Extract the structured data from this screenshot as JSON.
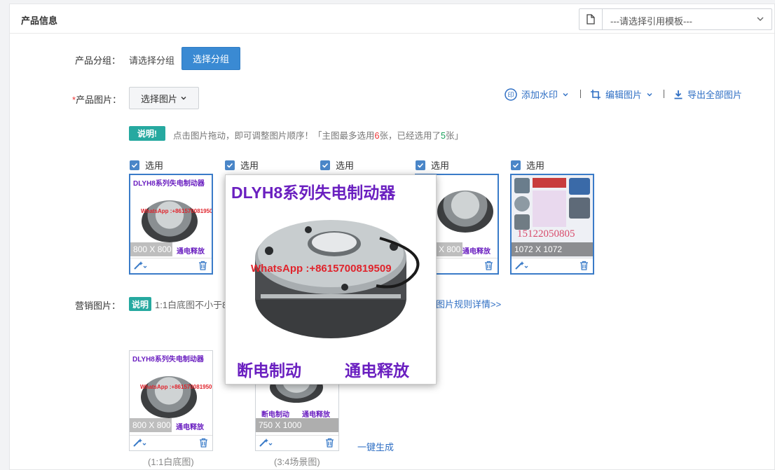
{
  "header": {
    "title": "产品信息",
    "template_select": "---请选择引用模板---"
  },
  "group": {
    "label": "产品分组：",
    "value": "请选择分组",
    "button": "选择分组"
  },
  "images": {
    "required_mark": "*",
    "label": "产品图片：",
    "select_button": "选择图片",
    "tools": {
      "watermark": "添加水印",
      "edit": "编辑图片",
      "export": "导出全部图片"
    },
    "note_badge": "说明!",
    "note_a": "点击图片拖动，即可调整图片顺序！「主图最多选用",
    "note_max": "6",
    "note_b": "张，已经选用了",
    "note_count": "5",
    "note_c": "张」",
    "check_label": "选用",
    "items": [
      {
        "title": "DLYH8系列失电制动器",
        "wa": "WhatsApp :+8615700819509",
        "dim": "800 X 800",
        "bottom": "通电释放"
      },
      {
        "title": "",
        "wa": "",
        "dim": "",
        "bottom": ""
      },
      {
        "title": "",
        "wa": "",
        "dim": "",
        "bottom": ""
      },
      {
        "title": "",
        "wa": "",
        "dim": "X 800",
        "bottom": "通电释放"
      },
      {
        "title": "",
        "wa": "",
        "dim": "1072 X 1072",
        "bottom": "",
        "phone": "15122050805"
      }
    ]
  },
  "popup": {
    "title": "DLYH8系列失电制动器",
    "wa": "WhatsApp :+8615700819509",
    "left": "断电制动",
    "right": "通电释放"
  },
  "marketing": {
    "label": "营销图片：",
    "badge": "说明",
    "desc": "1:1白底图不小于8",
    "rules_link": "图片规则详情>>",
    "items": [
      {
        "title": "DLYH8系列失电制动器",
        "wa": "WhatsApp :+8615700819509",
        "dim": "800 X 800",
        "bottom": "通电释放",
        "caption": "(1:1白底图)"
      },
      {
        "dim": "750 X 1000",
        "bottom_left": "断电制动",
        "bottom_right": "通电释放",
        "caption": "(3:4场景图)"
      }
    ],
    "generate": "一键生成"
  }
}
